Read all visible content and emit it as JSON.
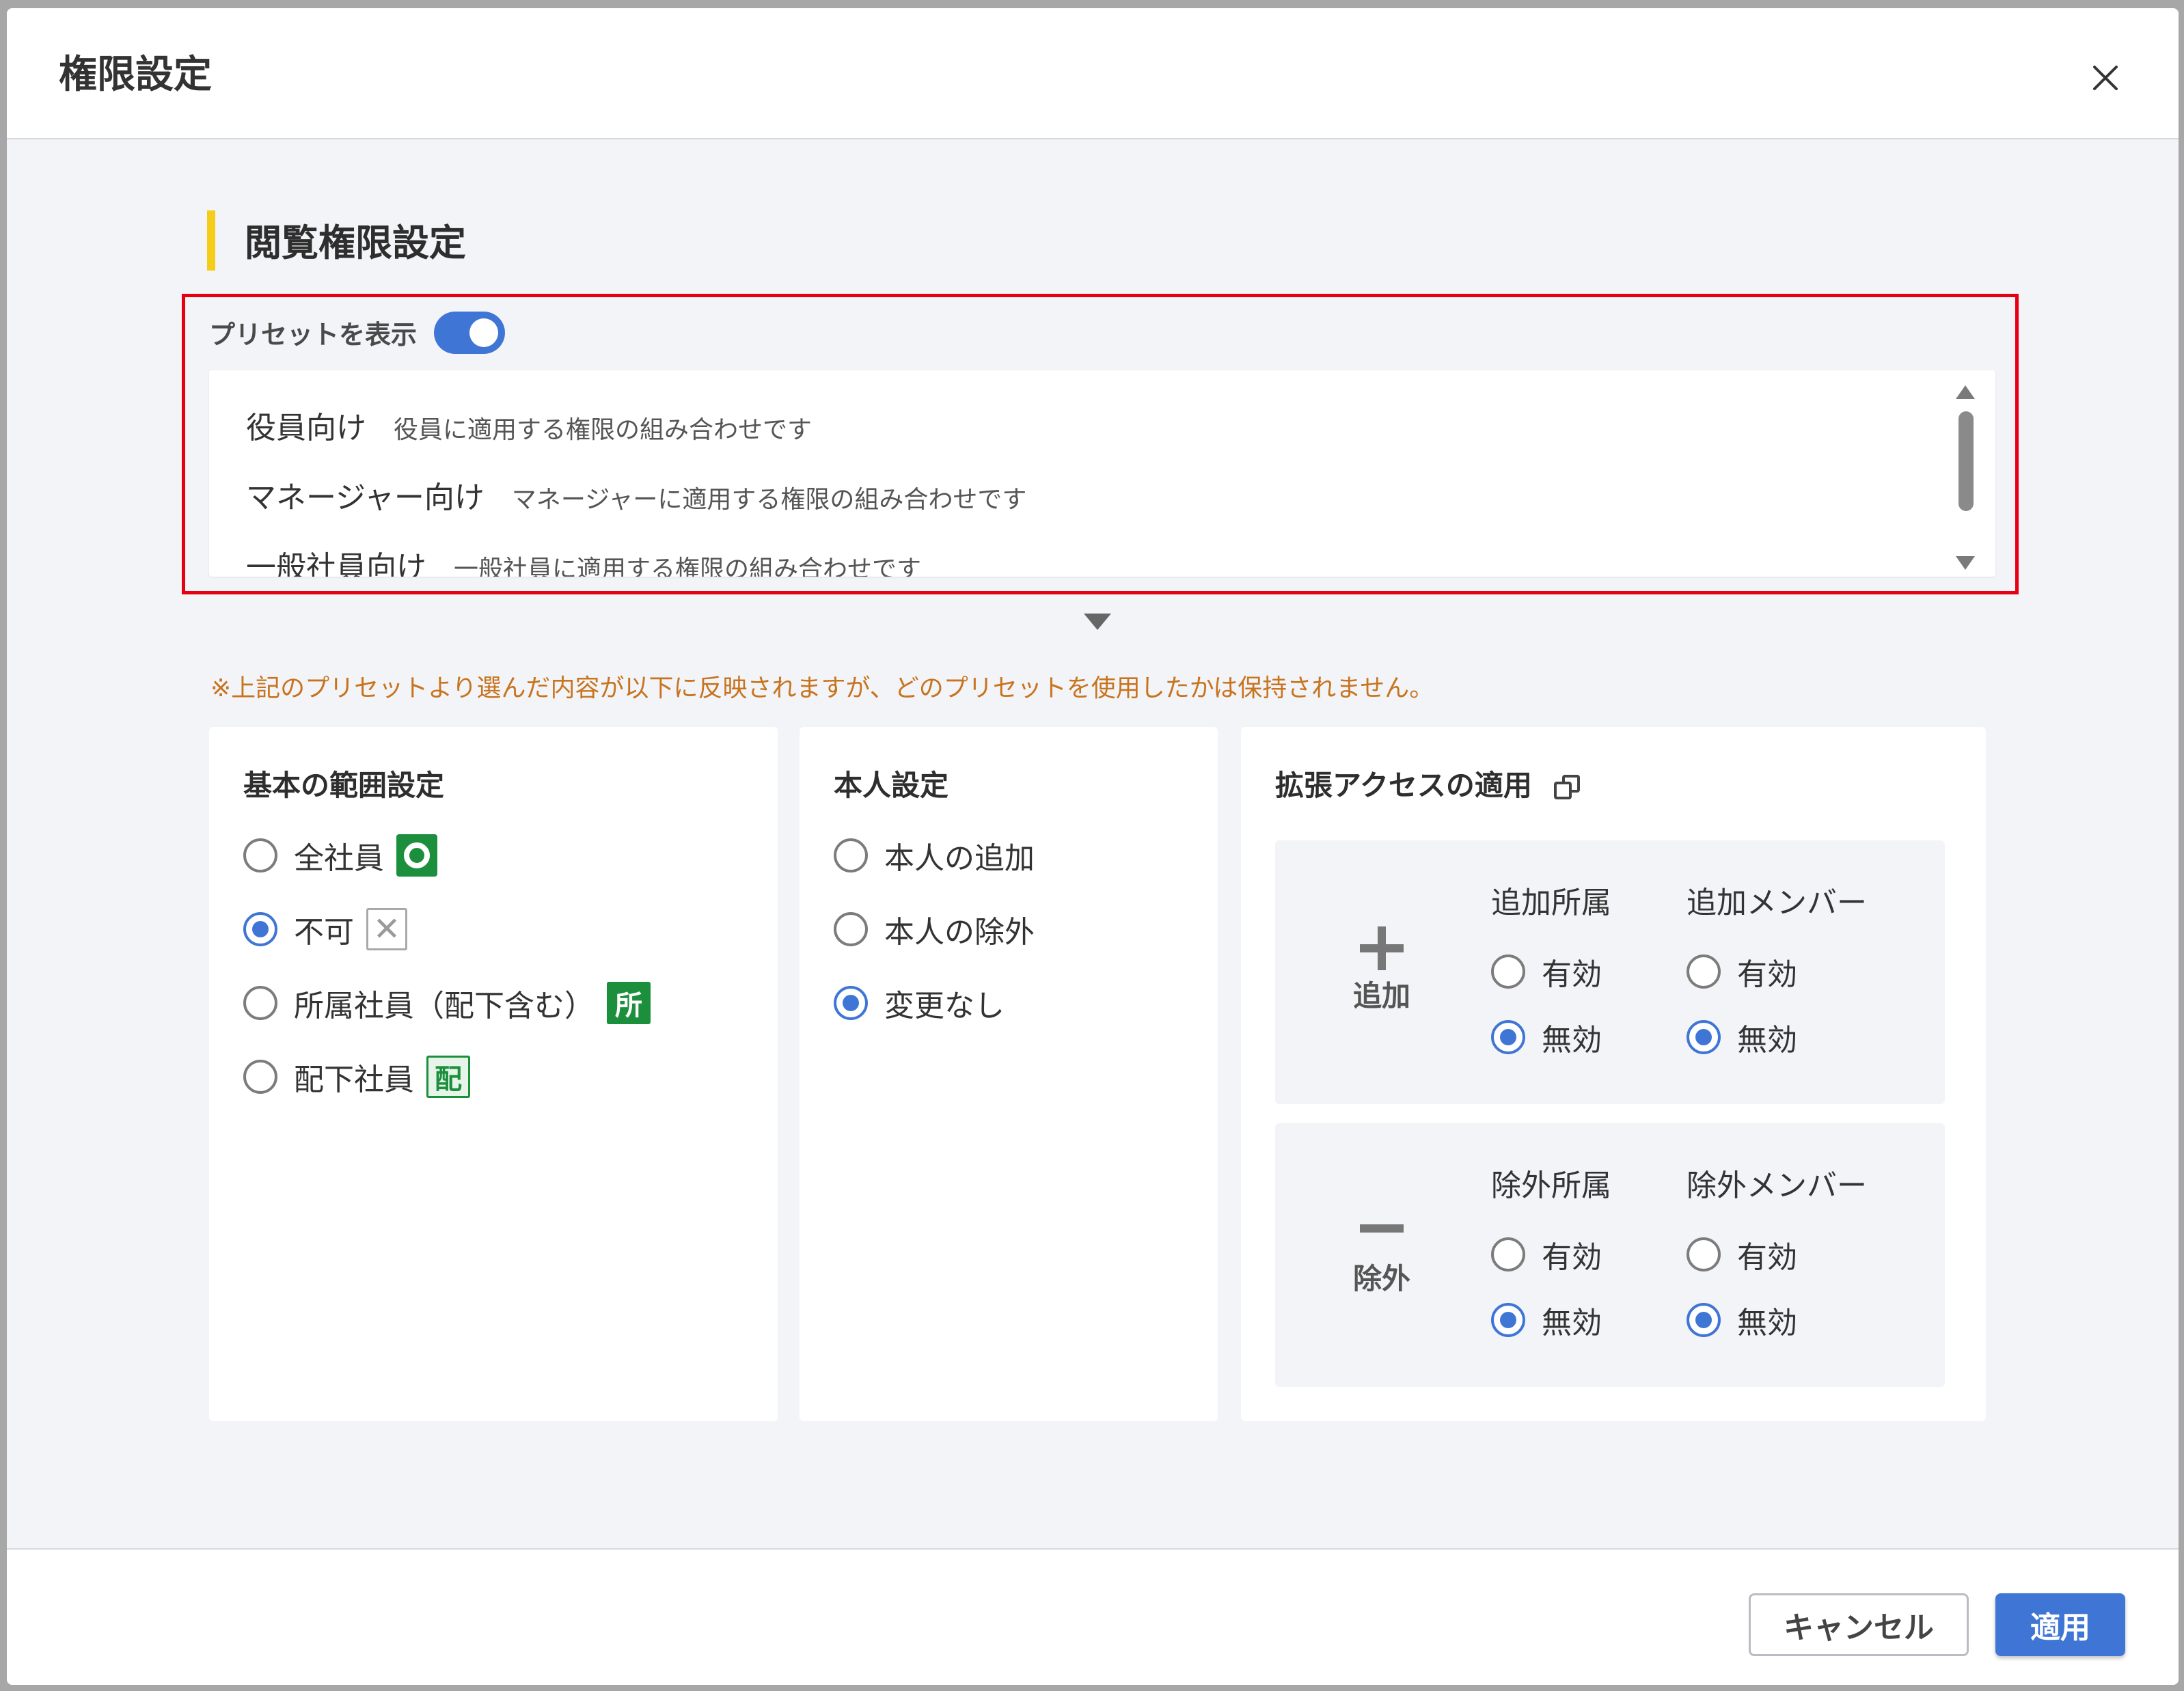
{
  "dialog": {
    "title": "権限設定"
  },
  "section": {
    "title": "閲覧権限設定"
  },
  "preset": {
    "toggle_label": "プリセットを表示",
    "toggle_on": true,
    "items": [
      {
        "name": "役員向け",
        "desc": "役員に適用する権限の組み合わせです"
      },
      {
        "name": "マネージャー向け",
        "desc": "マネージャーに適用する権限の組み合わせです"
      },
      {
        "name": "一般社員向け",
        "desc": "一般社員に適用する権限の組み合わせです"
      }
    ]
  },
  "notice": "※上記のプリセットより選んだ内容が以下に反映されますが、どのプリセットを使用したかは保持されません。",
  "basic_scope": {
    "title": "基本の範囲設定",
    "options": [
      {
        "label": "全社員",
        "checked": false,
        "badge": "circle-icon"
      },
      {
        "label": "不可",
        "checked": true,
        "badge": "x-icon"
      },
      {
        "label": "所属社員（配下含む）",
        "checked": false,
        "badge": "所"
      },
      {
        "label": "配下社員",
        "checked": false,
        "badge": "配"
      }
    ]
  },
  "self_setting": {
    "title": "本人設定",
    "options": [
      {
        "label": "本人の追加",
        "checked": false
      },
      {
        "label": "本人の除外",
        "checked": false
      },
      {
        "label": "変更なし",
        "checked": true
      }
    ]
  },
  "extended_access": {
    "title": "拡張アクセスの適用",
    "icon": "external-link-icon",
    "add": {
      "label": "追加",
      "col1": {
        "head": "追加所属",
        "enabled": "有効",
        "disabled": "無効",
        "value": "無効"
      },
      "col2": {
        "head": "追加メンバー",
        "enabled": "有効",
        "disabled": "無効",
        "value": "無効"
      }
    },
    "remove": {
      "label": "除外",
      "col1": {
        "head": "除外所属",
        "enabled": "有効",
        "disabled": "無効",
        "value": "無効"
      },
      "col2": {
        "head": "除外メンバー",
        "enabled": "有効",
        "disabled": "無効",
        "value": "無効"
      }
    }
  },
  "footer": {
    "cancel_label": "キャンセル",
    "apply_label": "適用"
  },
  "colors": {
    "accent": "#3f76d6",
    "section_bar": "#f5cc17",
    "highlight": "#e60012",
    "notice": "#c8741e",
    "badge_green": "#1b8f3c"
  }
}
